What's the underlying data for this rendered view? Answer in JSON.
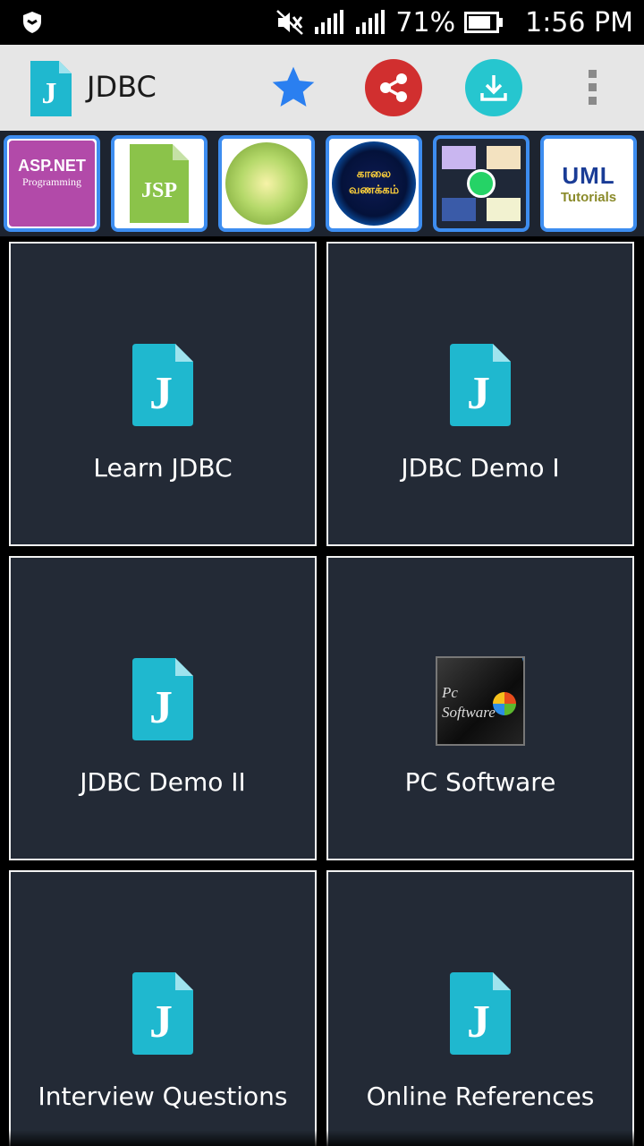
{
  "status_bar": {
    "battery_percent": "71%",
    "time": "1:56 PM"
  },
  "toolbar": {
    "title": "JDBC",
    "actions": [
      "star-icon",
      "share-icon",
      "download-icon",
      "more-vert-icon"
    ],
    "colors": {
      "star": "#2a7ff0",
      "share": "#d12f2f",
      "download": "#26c6cf"
    }
  },
  "app_strip": {
    "asp_title": "ASP.NET",
    "asp_subtitle": "Programming",
    "jsp_label": "JSP",
    "kalai_line1": "காலை",
    "kalai_line2": "வணக்கம்",
    "uml_title": "UML",
    "uml_subtitle": "Tutorials"
  },
  "tiles": [
    {
      "label": "Learn JDBC",
      "icon": "jdbc-file-icon"
    },
    {
      "label": "JDBC Demo I",
      "icon": "jdbc-file-icon"
    },
    {
      "label": "JDBC Demo II",
      "icon": "jdbc-file-icon"
    },
    {
      "label": "PC Software",
      "icon": "pc-software-icon",
      "icon_text_1": "Pc",
      "icon_text_2": "Software"
    },
    {
      "label": "Interview Questions",
      "icon": "jdbc-file-icon"
    },
    {
      "label": "Online References",
      "icon": "jdbc-file-icon"
    }
  ],
  "theme": {
    "accent": "#1fb8cf",
    "tile_bg": "#232a36",
    "strip_border": "#3d8df0"
  }
}
